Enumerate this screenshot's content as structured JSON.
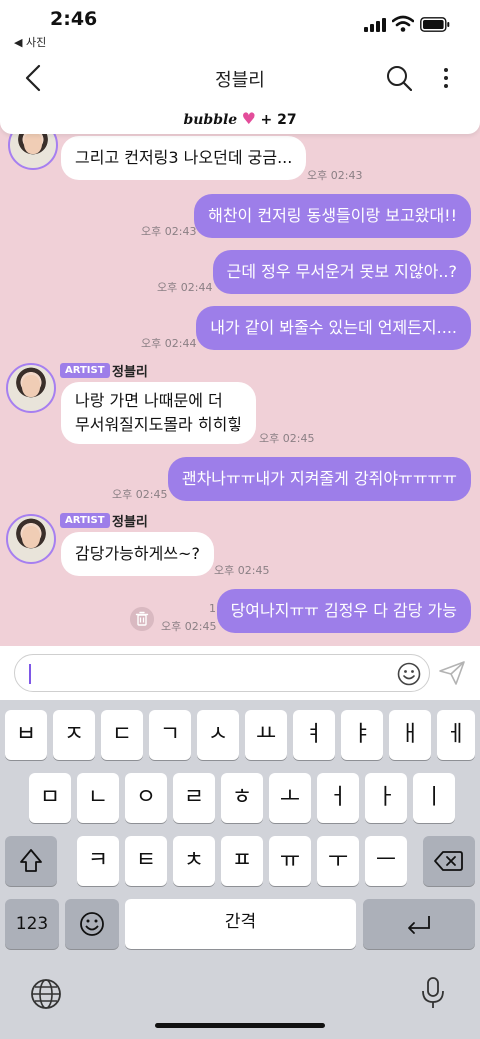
{
  "status": {
    "time": "2:46",
    "back_app": "◀ 사진"
  },
  "nav": {
    "title": "정블리"
  },
  "banner": {
    "brand": "bubble",
    "heart": "♥",
    "count": "+ 27"
  },
  "artist_badge": "ARTIST",
  "messages": [
    {
      "text": "그리고 컨저링3 나오던데 궁금...",
      "time": "오후 02:43"
    },
    {
      "text": "해찬이 컨저링 동생들이랑 보고왔대!!",
      "time": "오후 02:43"
    },
    {
      "text": "근데 정우 무서운거 못보 지않아..?",
      "time": "오후 02:44"
    },
    {
      "text": "내가 같이 봐줄수 있는데 언제든지....",
      "time": "오후 02:44"
    },
    {
      "sender": "정블리",
      "line1": "나랑 가면 나때문에 더",
      "line2": "무서워질지도몰라 히히힣",
      "time": "오후 02:45"
    },
    {
      "text": "괜차나ㅠㅠ내가 지켜줄게 강쥐야ㅠㅠㅠㅠ",
      "time": "오후 02:45"
    },
    {
      "sender": "정블리",
      "text": "감당가능하게쓰~?",
      "time": "오후 02:45"
    },
    {
      "text": "당여나지ㅠㅠ 김정우 다 감당 가능",
      "time": "오후 02:45",
      "unread": "1"
    }
  ],
  "keyboard": {
    "row1": [
      "ㅂ",
      "ㅈ",
      "ㄷ",
      "ㄱ",
      "ㅅ",
      "ㅛ",
      "ㅕ",
      "ㅑ",
      "ㅐ",
      "ㅔ"
    ],
    "row2": [
      "ㅁ",
      "ㄴ",
      "ㅇ",
      "ㄹ",
      "ㅎ",
      "ㅗ",
      "ㅓ",
      "ㅏ",
      "ㅣ"
    ],
    "row3": [
      "ㅋ",
      "ㅌ",
      "ㅊ",
      "ㅍ",
      "ㅠ",
      "ㅜ",
      "ㅡ"
    ],
    "num_label": "123",
    "space_label": "간격"
  },
  "colors": {
    "chat_bg": "#f0d0d7",
    "outgoing": "#9d7ee9",
    "accent": "#7e57e6",
    "heart": "#e34d9a"
  }
}
